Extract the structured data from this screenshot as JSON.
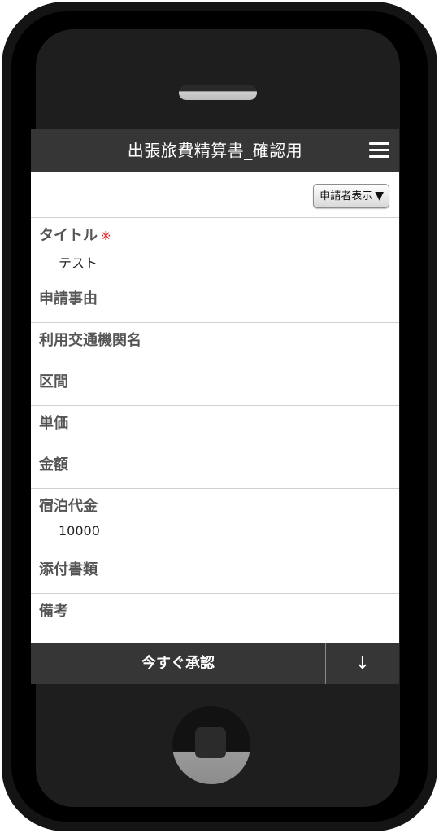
{
  "header": {
    "title": "出張旅費精算書_確認用",
    "menu_icon": "hamburger-menu-icon"
  },
  "toolbar": {
    "applicant_button_label": "申請者表示",
    "applicant_button_arrow": "▼"
  },
  "fields": [
    {
      "label": "タイトル",
      "required_mark": "※",
      "value": "テスト"
    },
    {
      "label": "申請事由",
      "value": ""
    },
    {
      "label": "利用交通機関名",
      "value": ""
    },
    {
      "label": "区間",
      "value": ""
    },
    {
      "label": "単価",
      "value": ""
    },
    {
      "label": "金額",
      "value": ""
    },
    {
      "label": "宿泊代金",
      "value": "10000"
    },
    {
      "label": "添付書類",
      "value": ""
    },
    {
      "label": "備考",
      "value": ""
    }
  ],
  "action_bar": {
    "approve_label": "今すぐ承認",
    "down_label": "↓"
  },
  "colors": {
    "header_bg": "#363636",
    "required": "#e0211f",
    "label": "#555555",
    "phone_body": "#141414"
  }
}
